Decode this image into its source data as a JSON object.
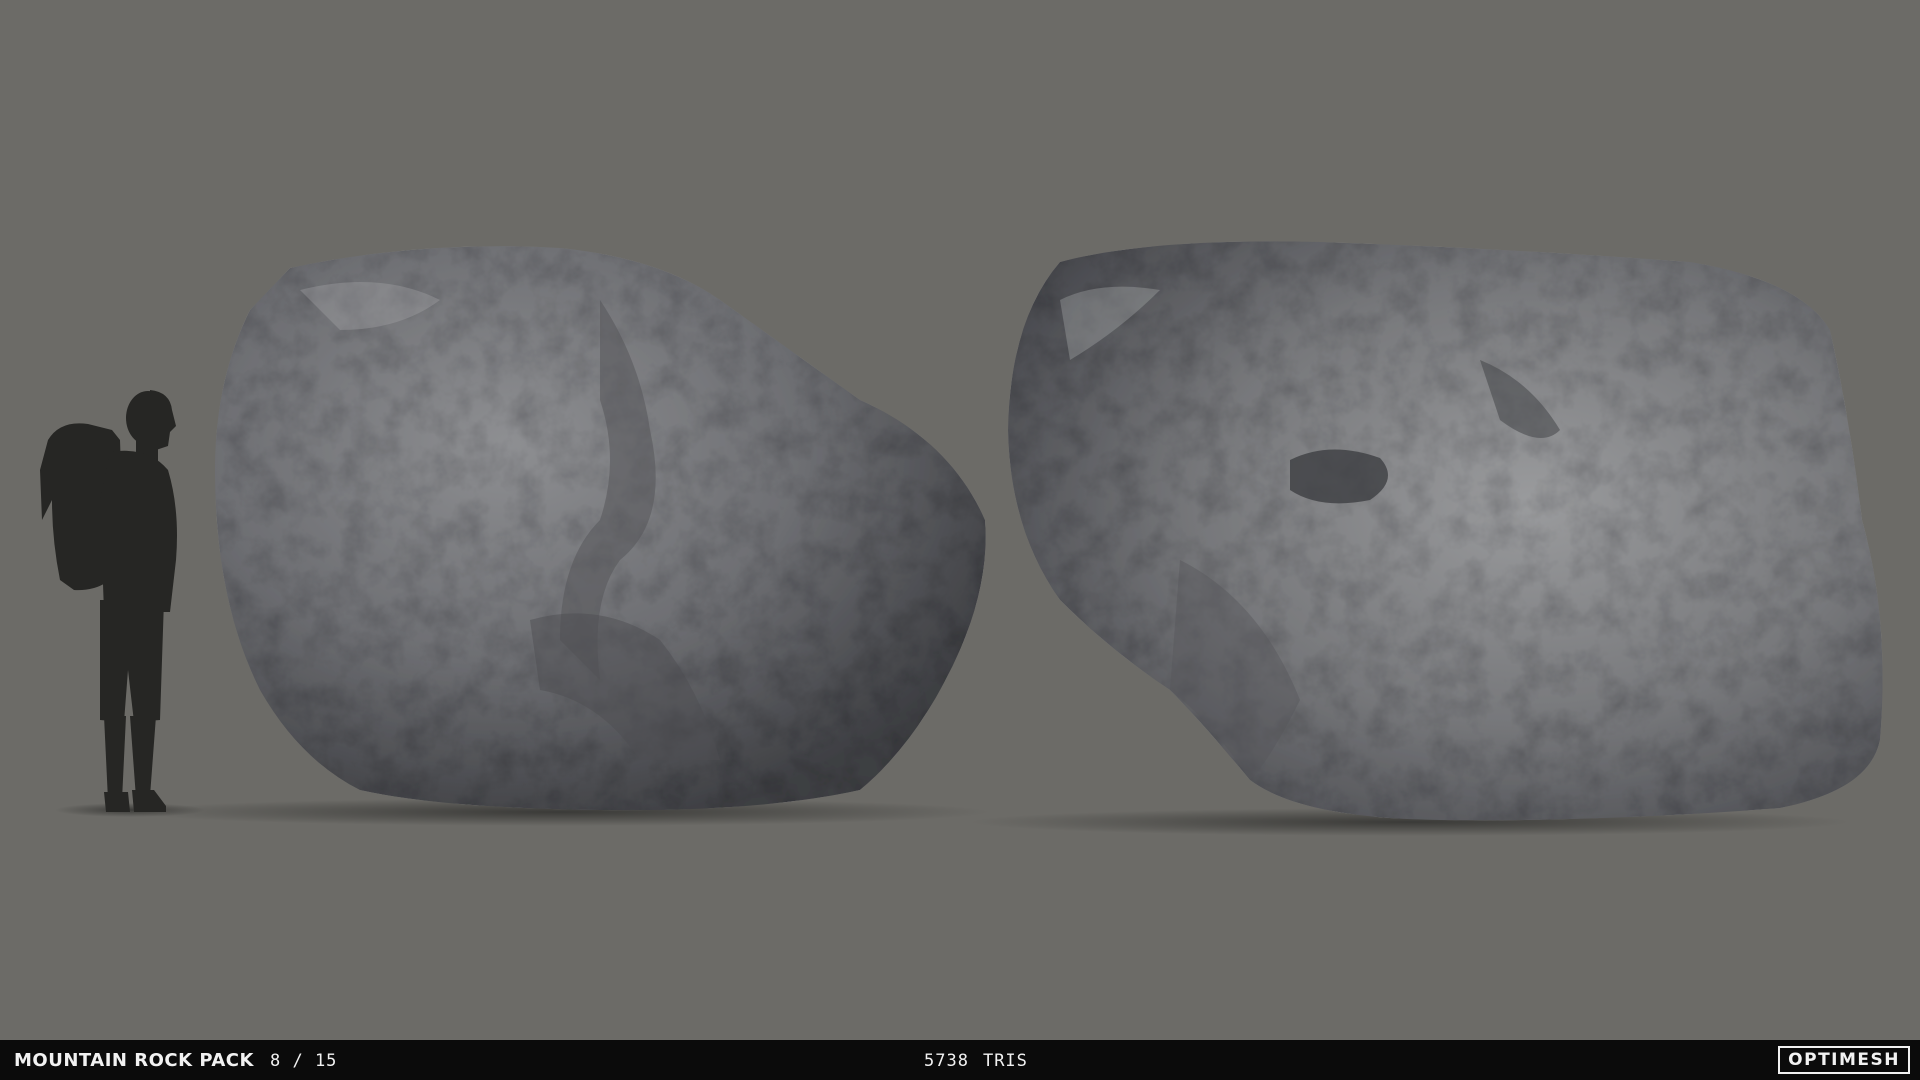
{
  "footer": {
    "title": "MOUNTAIN ROCK PACK",
    "page": "8 / 15",
    "tris_count": "5738",
    "tris_label": "TRIS",
    "brand": "OPTIMESH"
  },
  "colors": {
    "background": "#6c6b67",
    "bar": "#0b0b0b",
    "bar_text": "#f2f2f2",
    "silhouette": "#262624",
    "rock": "#77777a"
  }
}
